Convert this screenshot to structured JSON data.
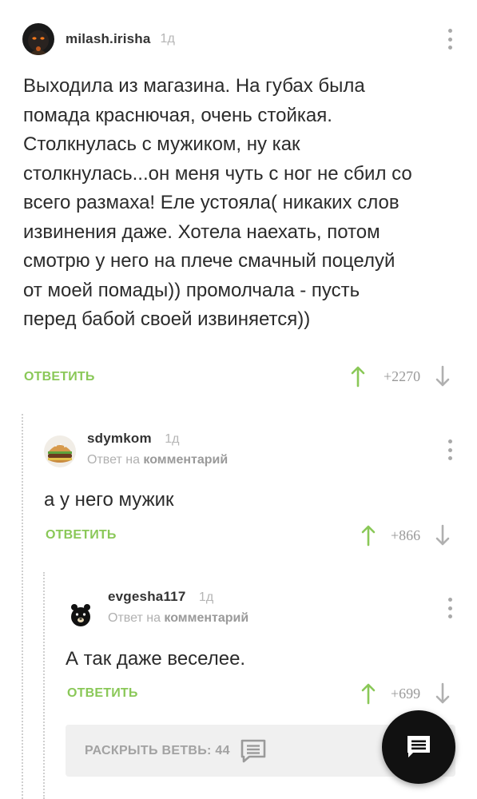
{
  "comments": [
    {
      "username": "milash.irisha",
      "time": "1д",
      "avatar_icon": "dark-avatar-icon",
      "text_lines": [
        "Выходила из магазина. На губах была",
        "помада краснючая, очень стойкая.",
        "Столкнулась с мужиком, ну как",
        "столкнулась...он меня чуть с ног не сбил со",
        "всего размаха! Еле устояла( никаких слов",
        "извинения даже. Хотела наехать, потом",
        "смотрю у него на плече смачный поцелуй",
        "от моей помады)) промолчала - пусть",
        "перед бабой своей извиняется))"
      ],
      "reply_label": "ОТВЕТИТЬ",
      "score": "+2270"
    },
    {
      "username": "sdymkom",
      "time": "1д",
      "avatar_icon": "burger-avatar-icon",
      "reply_to_prefix": "Ответ на",
      "reply_to_link": "комментарий",
      "text_lines": [
        "а у него мужик"
      ],
      "reply_label": "ОТВЕТИТЬ",
      "score": "+866"
    },
    {
      "username": "evgesha117",
      "time": "1д",
      "avatar_icon": "bear-avatar-icon",
      "reply_to_prefix": "Ответ на",
      "reply_to_link": "комментарий",
      "text_lines": [
        "А так даже веселее."
      ],
      "reply_label": "ОТВЕТИТЬ",
      "score": "+699"
    }
  ],
  "expand_branch": {
    "label": "РАСКРЫТЬ ВЕТВЬ: 44",
    "icon": "comments-icon"
  },
  "fab": {
    "icon": "comment-icon"
  },
  "colors": {
    "accent_green": "#8ac858",
    "muted_gray": "#a9a9a9",
    "fab_bg": "#111111"
  }
}
